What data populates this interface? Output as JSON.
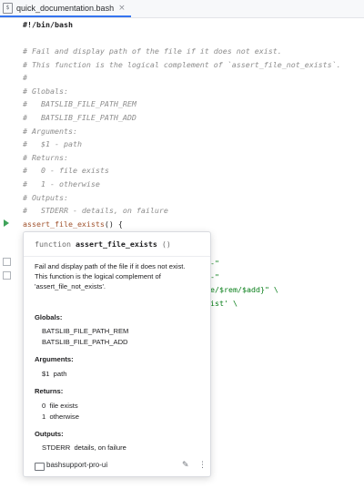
{
  "tab": {
    "label": "quick_documentation.bash",
    "close": "×"
  },
  "code": {
    "shebang": "#!/bin/bash",
    "comments": [
      "# Fail and display path of the file if it does not exist.",
      "# This function is the logical complement of `assert_file_not_exists`.",
      "#",
      "# Globals:",
      "#   BATSLIB_FILE_PATH_REM",
      "#   BATSLIB_FILE_PATH_ADD",
      "# Arguments:",
      "#   $1 - path",
      "# Returns:",
      "#   0 - file exists",
      "#   1 - otherwise",
      "# Outputs:",
      "#   STDERR - details, on failure"
    ],
    "fn_name": "assert_file_exists",
    "fn_rest": "() {",
    "hidden_fragments": [
      "-\"",
      "-\"",
      "e/$rem/$add}\" \\",
      "ist' \\"
    ]
  },
  "popup": {
    "keyword": "function",
    "name": "assert_file_exists",
    "parens": "()",
    "description": [
      "Fail and display path of the file if it does not exist.",
      "This function is the logical complement of",
      "'assert_file_not_exists'."
    ],
    "globals_label": "Globals:",
    "globals": [
      "BATSLIB_FILE_PATH_REM",
      "BATSLIB_FILE_PATH_ADD"
    ],
    "arguments_label": "Arguments:",
    "arguments": [
      "$1  path"
    ],
    "returns_label": "Returns:",
    "returns": [
      "0  file exists",
      "1  otherwise"
    ],
    "outputs_label": "Outputs:",
    "outputs": [
      "STDERR  details, on failure"
    ],
    "footer_label": "bashsupport-pro-ui",
    "edit_icon": "✎",
    "more_icon": "⋮"
  }
}
